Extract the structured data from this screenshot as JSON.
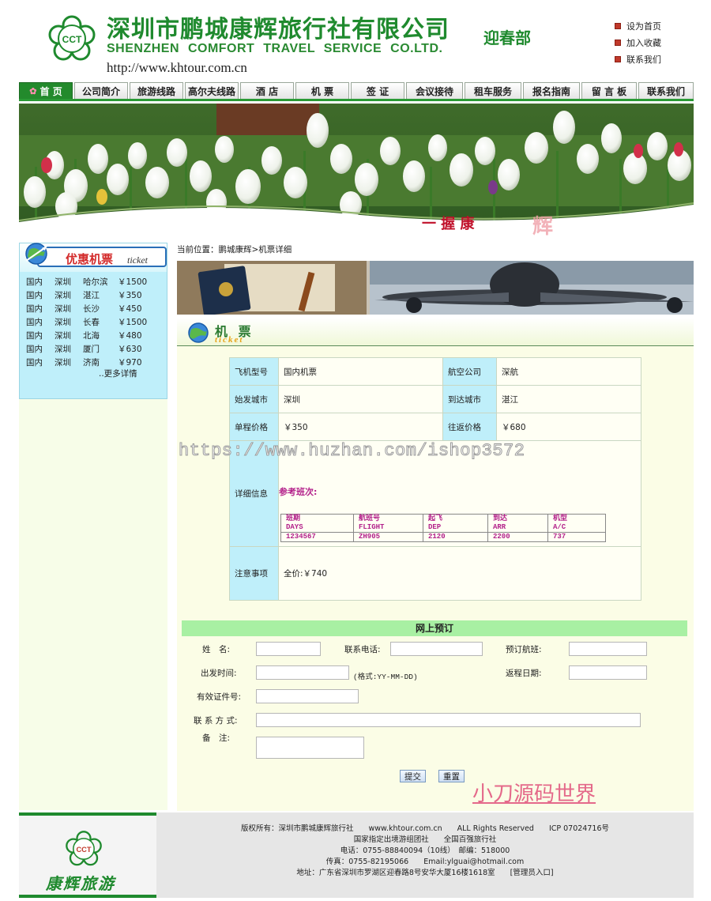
{
  "header": {
    "cn_name": "深圳市鹏城康辉旅行社有限公司",
    "dept": "迎春部",
    "en_name": "SHENZHEN COMFORT TRAVEL SERVICE CO.LTD.",
    "url": "http://www.khtour.com.cn",
    "logo_text": "CCT",
    "quick_links": [
      "设为首页",
      "加入收藏",
      "联系我们"
    ]
  },
  "nav": {
    "items": [
      "首 页",
      "公司简介",
      "旅游线路",
      "高尔夫线路",
      "酒 店",
      "机 票",
      "签 证",
      "会议接待",
      "租车服务",
      "报名指南",
      "留 言 板",
      "联系我们"
    ]
  },
  "banner": {
    "slogan": "一 握 康",
    "slogan2": "辉"
  },
  "sidebar": {
    "title": "优惠机票",
    "title_en": "ticket",
    "tickets": [
      {
        "type": "国内",
        "from": "深圳",
        "to": "哈尔滨",
        "price": "￥1500"
      },
      {
        "type": "国内",
        "from": "深圳",
        "to": "湛江",
        "price": "￥350"
      },
      {
        "type": "国内",
        "from": "深圳",
        "to": "长沙",
        "price": "￥450"
      },
      {
        "type": "国内",
        "from": "深圳",
        "to": "长春",
        "price": "￥1500"
      },
      {
        "type": "国内",
        "from": "深圳",
        "to": "北海",
        "price": "￥480"
      },
      {
        "type": "国内",
        "from": "深圳",
        "to": "厦门",
        "price": "￥630"
      },
      {
        "type": "国内",
        "from": "深圳",
        "to": "济南",
        "price": "￥970"
      }
    ],
    "more": "..更多详情"
  },
  "breadcrumb": "当前位置：鹏城康辉>机票详细",
  "ticket_head": {
    "cn": "机 票",
    "en": "ticket"
  },
  "detail": {
    "plane_type_label": "飞机型号",
    "plane_type": "国内机票",
    "airline_label": "航空公司",
    "airline": "深航",
    "from_label": "始发城市",
    "from": "深圳",
    "to_label": "到达城市",
    "to": "湛江",
    "single_label": "单程价格",
    "single": "￥350",
    "return_label": "往返价格",
    "return": "￥680",
    "info_label": "详细信息",
    "schedule_caption": "参考班次:",
    "schedule_headers": [
      [
        "班期",
        "DAYS"
      ],
      [
        "航班号",
        "FLIGHT"
      ],
      [
        "起飞",
        "DEP"
      ],
      [
        "到达",
        "ARR"
      ],
      [
        "机型",
        "A/C"
      ]
    ],
    "schedule_row": [
      "1234567",
      "ZH905",
      "2120",
      "2200",
      "737"
    ],
    "notes_label": "注意事项",
    "notes": "全价:￥740"
  },
  "form": {
    "title": "网上预订",
    "name_label": "姓　名:",
    "phone_label": "联系电话:",
    "flight_label": "预订航班:",
    "depart_label": "出发时间:",
    "date_hint": "(格式:YY-MM-DD)",
    "return_label": "返程日期:",
    "id_label": "有效证件号:",
    "contact_label": "联 系 方 式:",
    "remark_label": "备　注:",
    "submit": "提交",
    "reset": "重置"
  },
  "watermark": {
    "url": "https://www.huzhan.com/ishop3572",
    "author": "小刀源码世界"
  },
  "footer": {
    "brand": "康辉旅游",
    "logo_text": "CCT",
    "line1": "版权所有：深圳市鹏城康辉旅行社　　www.khtour.com.cn　　ALL Rights Reserved　　ICP 07024716号",
    "line2": "国家指定出境游组团社　　全国百强旅行社",
    "line3": "电话：0755-88840094（10线）　邮编：518000",
    "line4": "传真：0755-82195066　　Email:ylguai@hotmail.com",
    "line5": "地址：广东省深圳市罗湖区迎春路8号安华大厦16楼1618室　　[管理员入口]"
  },
  "colors": {
    "brand_green": "#1f8a2e",
    "sidebar_blue": "#bfeffa",
    "accent_magenta": "#b3208a",
    "form_head": "#a8f0a3"
  }
}
